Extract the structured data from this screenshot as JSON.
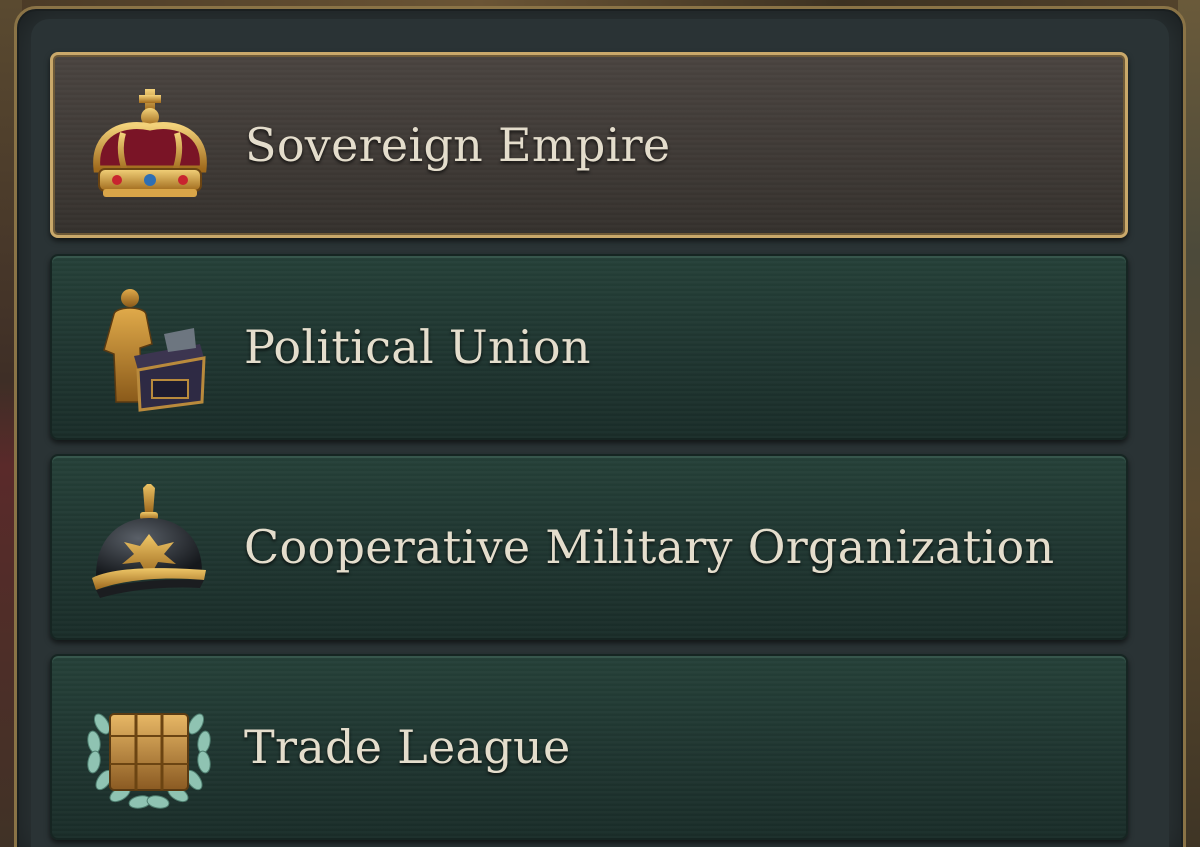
{
  "panel": {
    "options": [
      {
        "label": "Sovereign Empire",
        "icon": "crown-icon",
        "selected": true
      },
      {
        "label": "Political Union",
        "icon": "statesman-podium-icon",
        "selected": false
      },
      {
        "label": "Cooperative Military Organization",
        "icon": "spiked-helmet-icon",
        "selected": false
      },
      {
        "label": "Trade League",
        "icon": "trade-goods-laurel-icon",
        "selected": false
      }
    ]
  },
  "colors": {
    "frame_gold": "#c9a86a",
    "option_green": "#1f3530",
    "selected_brown": "#3e3935",
    "text": "#e4ddcc"
  }
}
